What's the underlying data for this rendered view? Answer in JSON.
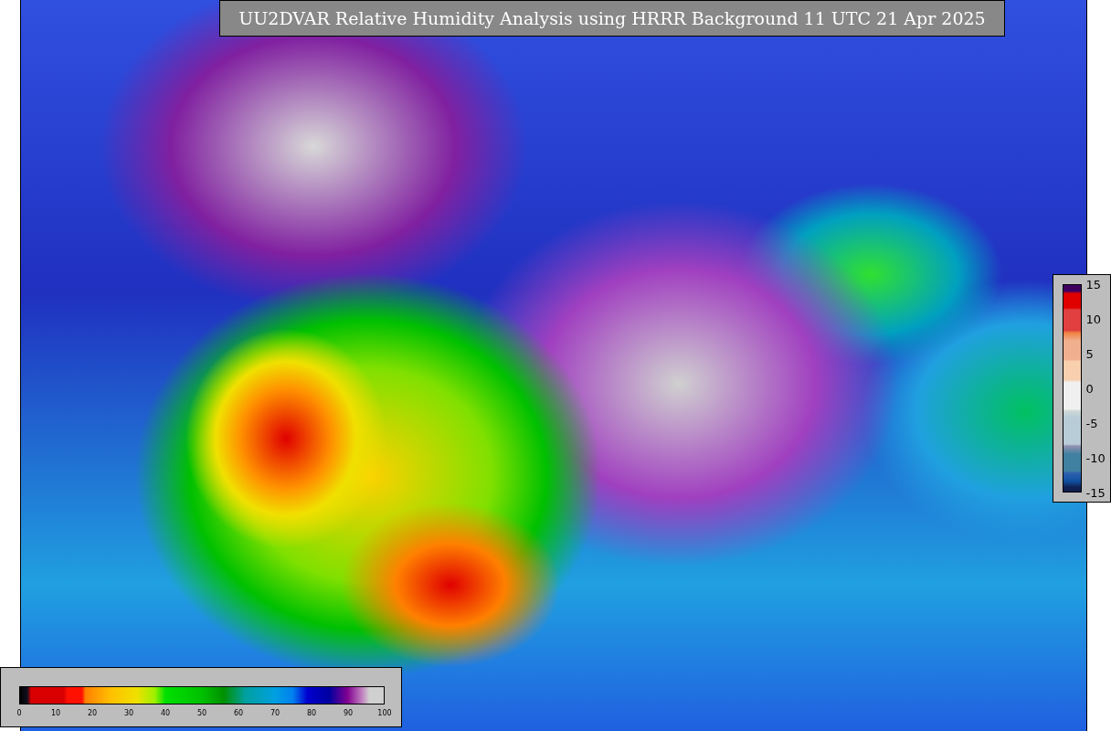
{
  "title": "UU2DVAR Relative Humidity Analysis using HRRR Background 11 UTC 21 Apr 2025",
  "humidity_colorbar": {
    "ticks": [
      "0",
      "10",
      "20",
      "30",
      "40",
      "50",
      "60",
      "70",
      "80",
      "90",
      "100"
    ]
  },
  "anomaly_colorbar": {
    "ticks": [
      "15",
      "10",
      "5",
      "0",
      "-5",
      "-10",
      "-15"
    ]
  }
}
